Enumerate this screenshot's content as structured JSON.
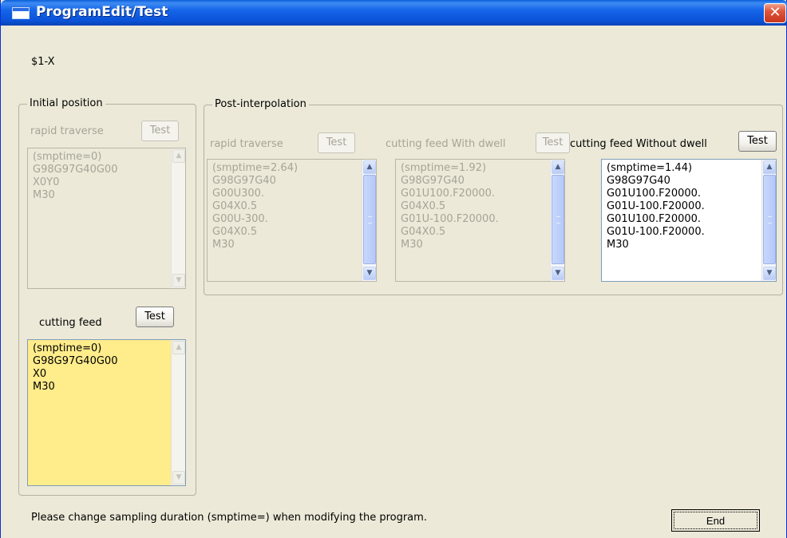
{
  "window": {
    "title": "ProgramEdit/Test",
    "close_glyph": "✕"
  },
  "axis_label": "$1-X",
  "initial_position": {
    "title": "Initial position",
    "rapid": {
      "label": "rapid traverse",
      "button": "Test",
      "lines": [
        "(smptime=0)",
        "G98G97G40G00",
        "X0Y0",
        "M30"
      ]
    },
    "cutting": {
      "label": "cutting feed",
      "button": "Test",
      "lines": [
        "(smptime=0)",
        "G98G97G40G00",
        "X0",
        "M30"
      ]
    }
  },
  "post_interpolation": {
    "title": "Post-interpolation",
    "panels": [
      {
        "label": "rapid traverse",
        "button": "Test",
        "lines": [
          "(smptime=2.64)",
          "G98G97G40",
          "G00U300.",
          "G04X0.5",
          "G00U-300.",
          "G04X0.5",
          "M30"
        ]
      },
      {
        "label": "cutting feed With dwell",
        "button": "Test",
        "lines": [
          "(smptime=1.92)",
          "G98G97G40",
          "G01U100.F20000.",
          "G04X0.5",
          "G01U-100.F20000.",
          "G04X0.5",
          "M30"
        ]
      },
      {
        "label": "cutting feed Without dwell",
        "button": "Test",
        "lines": [
          "(smptime=1.44)",
          "G98G97G40",
          "G01U100.F20000.",
          "G01U-100.F20000.",
          "G01U100.F20000.",
          "G01U-100.F20000.",
          "M30"
        ]
      }
    ]
  },
  "footer": {
    "message": "Please change sampling duration (smptime=) when modifying the program.",
    "end_button": "End"
  },
  "scroll": {
    "up": "▲",
    "down": "▼"
  },
  "colors": {
    "titlebar": "#0b53d9",
    "yellow_field": "#ffec8b",
    "window_bg": "#ece9d8"
  }
}
